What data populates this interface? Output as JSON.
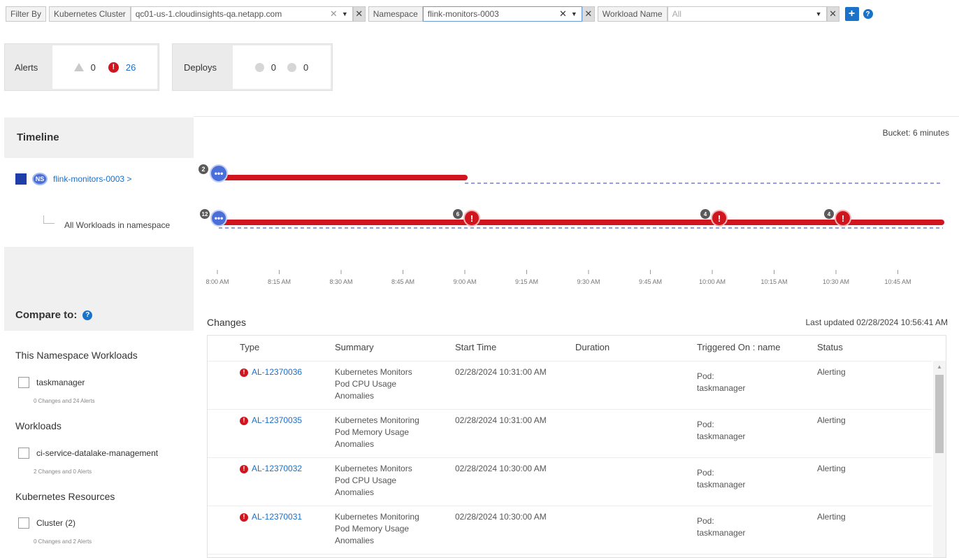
{
  "filter": {
    "filter_by": "Filter By",
    "cluster_label": "Kubernetes Cluster",
    "cluster_value": "qc01-us-1.cloudinsights-qa.netapp.com",
    "namespace_label": "Namespace",
    "namespace_value": "flink-monitors-0003",
    "workload_label": "Workload Name",
    "workload_placeholder": "All"
  },
  "alerts_card": {
    "title": "Alerts",
    "warning_count": "0",
    "critical_count": "26"
  },
  "deploys_card": {
    "title": "Deploys",
    "count_a": "0",
    "count_b": "0"
  },
  "timeline": {
    "title": "Timeline",
    "bucket": "Bucket: 6 minutes",
    "namespace_row": {
      "icon_text": "NS",
      "label": "flink-monitors-0003 >"
    },
    "workload_row": {
      "label": "All Workloads in namespace"
    },
    "ticks": [
      "8:00 AM",
      "8:15 AM",
      "8:30 AM",
      "8:45 AM",
      "9:00 AM",
      "9:15 AM",
      "9:30 AM",
      "9:45 AM",
      "10:00 AM",
      "10:15 AM",
      "10:30 AM",
      "10:45 AM"
    ],
    "row1_badge": "2",
    "row2_badges": [
      {
        "time": "8:00 AM",
        "count": "12",
        "kind": "info"
      },
      {
        "time": "9:00 AM",
        "count": "6",
        "kind": "alert"
      },
      {
        "time": "10:00 AM",
        "count": "4",
        "kind": "alert"
      },
      {
        "time": "10:30 AM",
        "count": "4",
        "kind": "alert"
      }
    ],
    "series_colors": {
      "active": "#d0151f",
      "idle": "#6b7fd8",
      "info_badge": "#4a6fd8",
      "count_badge": "#5a5a5a"
    }
  },
  "compare": {
    "title": "Compare to:",
    "sections": [
      {
        "title": "This Namespace Workloads",
        "item": "taskmanager",
        "sub": "0 Changes and 24 Alerts"
      },
      {
        "title": "Workloads",
        "item": "ci-service-datalake-management",
        "sub": "2 Changes and 0 Alerts"
      },
      {
        "title": "Kubernetes Resources",
        "item": "Cluster (2)",
        "sub": "0 Changes and 2 Alerts"
      }
    ]
  },
  "changes": {
    "title": "Changes",
    "updated": "Last updated 02/28/2024 10:56:41 AM",
    "headers": [
      "Type",
      "Summary",
      "Start Time",
      "Duration",
      "Triggered On : name",
      "Status"
    ],
    "rows": [
      {
        "id": "AL-12370036",
        "summary": [
          "Kubernetes Monitors",
          "Pod CPU Usage",
          "Anomalies"
        ],
        "start": "02/28/2024 10:31:00 AM",
        "duration": "",
        "trigger": [
          "Pod:",
          "taskmanager"
        ],
        "status": "Alerting"
      },
      {
        "id": "AL-12370035",
        "summary": [
          "Kubernetes Monitoring",
          "Pod Memory Usage",
          "Anomalies"
        ],
        "start": "02/28/2024 10:31:00 AM",
        "duration": "",
        "trigger": [
          "Pod:",
          "taskmanager"
        ],
        "status": "Alerting"
      },
      {
        "id": "AL-12370032",
        "summary": [
          "Kubernetes Monitors",
          "Pod CPU Usage",
          "Anomalies"
        ],
        "start": "02/28/2024 10:30:00 AM",
        "duration": "",
        "trigger": [
          "Pod:",
          "taskmanager"
        ],
        "status": "Alerting"
      },
      {
        "id": "AL-12370031",
        "summary": [
          "Kubernetes Monitoring",
          "Pod Memory Usage",
          "Anomalies"
        ],
        "start": "02/28/2024 10:30:00 AM",
        "duration": "",
        "trigger": [
          "Pod:",
          "taskmanager"
        ],
        "status": "Alerting"
      }
    ]
  }
}
